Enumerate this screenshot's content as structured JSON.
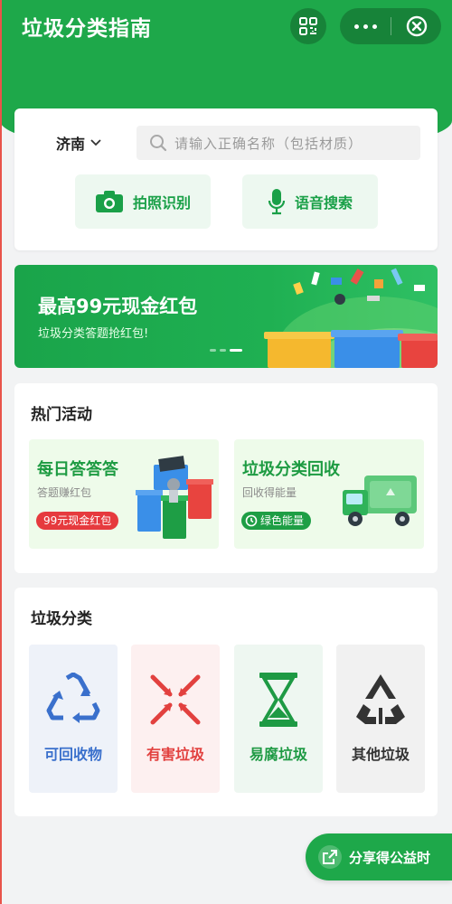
{
  "header": {
    "title": "垃圾分类指南",
    "scan_icon": "scan-code-icon",
    "more_icon": "more-dots-icon",
    "close_icon": "close-circle-icon",
    "color": "#1ea84a"
  },
  "search": {
    "city": "济南",
    "placeholder": "请输入正确名称（包括材质）",
    "photo_label": "拍照识别",
    "voice_label": "语音搜索"
  },
  "banner": {
    "title": "最高99元现金红包",
    "subtitle": "垃圾分类答题抢红包!",
    "page_count": 3,
    "active_page": 3
  },
  "hot": {
    "title": "热门活动",
    "activities": [
      {
        "title": "每日答答答",
        "subtitle": "答题赚红包",
        "badge": "99元现金红包"
      },
      {
        "title": "垃圾分类回收",
        "subtitle": "回收得能量",
        "badge": "绿色能量"
      }
    ]
  },
  "categories": {
    "title": "垃圾分类",
    "items": [
      {
        "label": "可回收物",
        "icon": "recycle-icon",
        "color": "#3a70cc"
      },
      {
        "label": "有害垃圾",
        "icon": "hazard-arrows-icon",
        "color": "#e2413f"
      },
      {
        "label": "易腐垃圾",
        "icon": "hourglass-icon",
        "color": "#1e9a44"
      },
      {
        "label": "其他垃圾",
        "icon": "other-recycle-icon",
        "color": "#333333"
      }
    ]
  },
  "share": {
    "label": "分享得公益时"
  }
}
